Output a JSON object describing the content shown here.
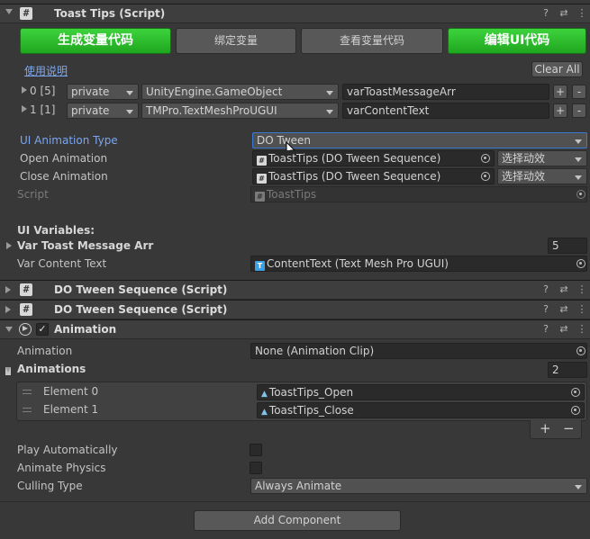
{
  "toast": {
    "title": "Toast Tips (Script)",
    "buttons": {
      "gen_var": "生成变量代码",
      "bind_var": "绑定变量",
      "view_var": "查看变量代码",
      "edit_ui": "编辑UI代码"
    },
    "usage_link": "使用说明",
    "clear_all": "Clear All",
    "rows": [
      {
        "index": "0 [5]",
        "access": "private",
        "type": "UnityEngine.GameObject",
        "name": "varToastMessageArr"
      },
      {
        "index": "1 [1]",
        "access": "private",
        "type": "TMPro.TextMeshProUGUI",
        "name": "varContentText"
      }
    ],
    "ui_anim_type_label": "UI Animation Type",
    "ui_anim_type_value": "DO Tween",
    "open_anim_label": "Open Animation",
    "open_anim_value": "ToastTips (DO Tween Sequence)",
    "open_anim_select": "选择动效",
    "close_anim_label": "Close Animation",
    "close_anim_value": "ToastTips (DO Tween Sequence)",
    "close_anim_select": "选择动效",
    "script_label": "Script",
    "script_value": "ToastTips",
    "ui_vars_header": "UI Variables:",
    "var_toast_label": "Var Toast Message Arr",
    "var_toast_size": "5",
    "var_content_label": "Var Content Text",
    "var_content_value": "ContentText (Text Mesh Pro UGUI)"
  },
  "seq1": {
    "title": "DO Tween Sequence (Script)"
  },
  "seq2": {
    "title": "DO Tween Sequence (Script)"
  },
  "animation": {
    "title": "Animation",
    "anim_label": "Animation",
    "anim_value": "None (Animation Clip)",
    "anims_label": "Animations",
    "anims_size": "2",
    "elements": [
      {
        "label": "Element 0",
        "value": "ToastTips_Open"
      },
      {
        "label": "Element 1",
        "value": "ToastTips_Close"
      }
    ],
    "play_auto_label": "Play Automatically",
    "anim_physics_label": "Animate Physics",
    "culling_label": "Culling Type",
    "culling_value": "Always Animate"
  },
  "add_component": "Add Component",
  "colors": {
    "green": "#2ec02e",
    "link": "#7aa6f0",
    "focus": "#3a79d4"
  }
}
